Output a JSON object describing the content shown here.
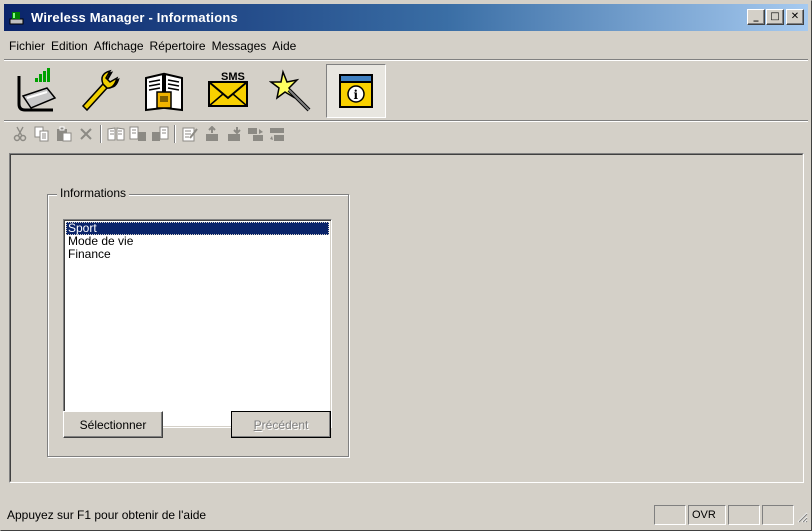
{
  "window": {
    "title": "Wireless Manager - Informations",
    "minimize_glyph": "_",
    "maximize_glyph": "□",
    "close_glyph": "✕"
  },
  "menu": [
    {
      "label": "Fichier"
    },
    {
      "label": "Edition"
    },
    {
      "label": "Affichage"
    },
    {
      "label": "Répertoire"
    },
    {
      "label": "Messages"
    },
    {
      "label": "Aide"
    }
  ],
  "big_toolbar": [
    {
      "icon": "phone-connection-icon"
    },
    {
      "icon": "wrench-icon"
    },
    {
      "icon": "phonebook-icon"
    },
    {
      "icon": "sms-envelope-icon",
      "text": "SMS"
    },
    {
      "icon": "magic-wand-icon"
    },
    {
      "icon": "info-icon",
      "text": "i",
      "active": true
    }
  ],
  "small_toolbar": [
    {
      "icon": "cut-icon"
    },
    {
      "icon": "copy-icon"
    },
    {
      "icon": "paste-icon"
    },
    {
      "icon": "delete-icon"
    },
    {
      "icon": "open-book-icon"
    },
    {
      "icon": "copy-to-phone-icon"
    },
    {
      "icon": "copy-from-phone-icon"
    },
    {
      "icon": "edit-icon"
    },
    {
      "icon": "upload-icon"
    },
    {
      "icon": "download-icon"
    },
    {
      "icon": "send-icon"
    },
    {
      "icon": "receive-icon"
    }
  ],
  "informations": {
    "group_title": "Informations",
    "items": [
      {
        "label": "Sport",
        "selected": true
      },
      {
        "label": "Mode de vie",
        "selected": false
      },
      {
        "label": "Finance",
        "selected": false
      }
    ],
    "select_button": "Sélectionner",
    "previous_button": "Précédent"
  },
  "statusbar": {
    "help_text": "Appuyez sur F1 pour obtenir de l'aide",
    "pane_1": "",
    "pane_ovr": "OVR",
    "pane_3": "",
    "pane_4": ""
  },
  "colors": {
    "title_gradient_start": "#0a246a",
    "title_gradient_end": "#a6caf0",
    "selection": "#0a246a",
    "face": "#d4d0c8"
  }
}
